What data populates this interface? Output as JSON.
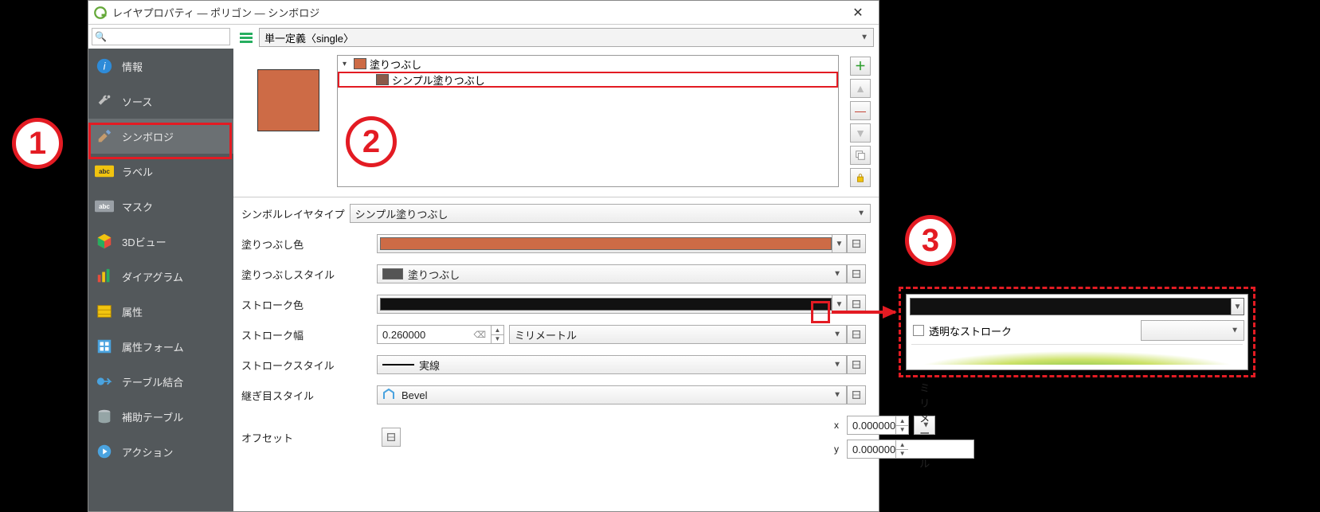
{
  "window": {
    "title": "レイヤプロパティ — ポリゴン — シンボロジ"
  },
  "search": {
    "placeholder": ""
  },
  "sidebar": {
    "items": [
      {
        "label": "情報"
      },
      {
        "label": "ソース"
      },
      {
        "label": "シンボロジ"
      },
      {
        "label": "ラベル"
      },
      {
        "label": "マスク"
      },
      {
        "label": "3Dビュー"
      },
      {
        "label": "ダイアグラム"
      },
      {
        "label": "属性"
      },
      {
        "label": "属性フォーム"
      },
      {
        "label": "テーブル結合"
      },
      {
        "label": "補助テーブル"
      },
      {
        "label": "アクション"
      }
    ]
  },
  "renderer": {
    "label": "単一定義〈single〉"
  },
  "tree": {
    "root": "塗りつぶし",
    "child": "シンプル塗りつぶし"
  },
  "symbolLayerType": {
    "label": "シンボルレイヤタイプ",
    "value": "シンプル塗りつぶし"
  },
  "props": {
    "fillColor": {
      "label": "塗りつぶし色",
      "hex": "#cd6b46"
    },
    "fillStyle": {
      "label": "塗りつぶしスタイル",
      "value": "塗りつぶし"
    },
    "strokeColor": {
      "label": "ストローク色",
      "hex": "#111111"
    },
    "strokeWidth": {
      "label": "ストローク幅",
      "value": "0.260000",
      "unit": "ミリメートル"
    },
    "strokeStyle": {
      "label": "ストロークスタイル",
      "value": "実線"
    },
    "joinStyle": {
      "label": "継ぎ目スタイル",
      "value": "Bevel"
    },
    "offset": {
      "label": "オフセット",
      "x_label": "x",
      "y_label": "y",
      "x": "0.000000",
      "y": "0.000000",
      "unit": "ミリメートル"
    }
  },
  "popup": {
    "transparent": "透明なストローク"
  },
  "annot": {
    "n1": "1",
    "n2": "2",
    "n3": "3"
  },
  "sidebar_extra": {
    "abc": "abc"
  }
}
